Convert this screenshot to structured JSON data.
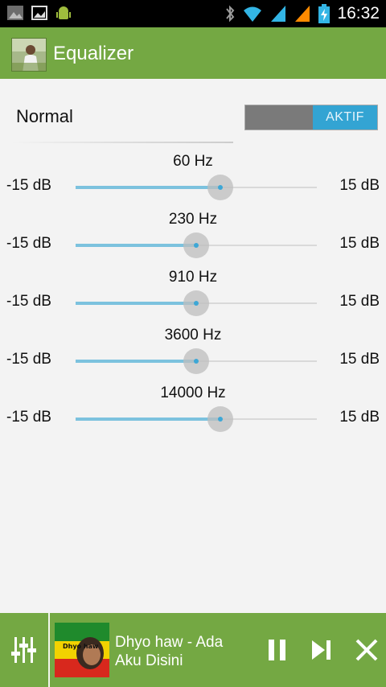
{
  "status_bar": {
    "time": "16:32"
  },
  "app": {
    "title": "Equalizer"
  },
  "preset": {
    "name": "Normal",
    "toggle_label": "AKTIF",
    "toggle_on": true
  },
  "bands": [
    {
      "freq": "60 Hz",
      "min_label": "-15 dB",
      "max_label": "15 dB",
      "level_fraction": 0.6
    },
    {
      "freq": "230 Hz",
      "min_label": "-15 dB",
      "max_label": "15 dB",
      "level_fraction": 0.5
    },
    {
      "freq": "910 Hz",
      "min_label": "-15 dB",
      "max_label": "15 dB",
      "level_fraction": 0.5
    },
    {
      "freq": "3600 Hz",
      "min_label": "-15 dB",
      "max_label": "15 dB",
      "level_fraction": 0.5
    },
    {
      "freq": "14000 Hz",
      "min_label": "-15 dB",
      "max_label": "15 dB",
      "level_fraction": 0.6
    }
  ],
  "player": {
    "song_title": "Dhyo haw - Ada Aku Disini",
    "album_art_text": "Dhyo haw"
  },
  "colors": {
    "accent": "#74a843",
    "slider": "#7cc2de",
    "toggle": "#33a4d3"
  }
}
